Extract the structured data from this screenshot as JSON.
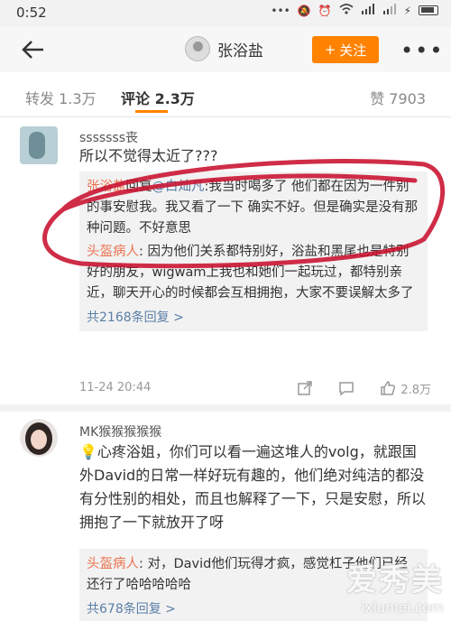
{
  "status_bar": {
    "time": "0:52"
  },
  "nav": {
    "title": "张浴盐",
    "follow_label": "关注",
    "follow_plus": "+",
    "more": "•••"
  },
  "tabs": {
    "repost": "转发 1.3万",
    "comment": "评论 2.3万",
    "like": "赞 7903"
  },
  "comments": [
    {
      "name": "sssssss丧",
      "text": "所以不觉得太近了???",
      "replies": [
        {
          "author": "张浴盐",
          "verb": "回复",
          "mention": "@白灿凡",
          "text": ":我当时喝多了 他们都在因为一件别的事安慰我。我又看了一下 确实不好。但是确实是没有那种问题。不好意思"
        },
        {
          "author": "头盔病人",
          "text": ": 因为他们关系都特别好，浴盐和黑尾也是特别好的朋友，wigwam上我也和她们一起玩过，都特别亲近，聊天开心的时候都会互相拥抱，大家不要误解太多了"
        }
      ],
      "more_replies": "共2168条回复 >",
      "time": "11-24 20:44",
      "likes": "2.8万"
    },
    {
      "name": "MK猴猴猴猴猴",
      "text": "心疼浴姐，你们可以看一遍这堆人的volg，就跟国外David的日常一样好玩有趣的，他们绝对纯洁的都没有分性别的相处，而且也解释了一下，只是安慰，所以拥抱了一下就放开了呀",
      "replies": [
        {
          "author": "头盔病人",
          "text": ": 对，David他们玩得才疯，感觉杠子他们已经还行了哈哈哈哈哈"
        }
      ],
      "more_replies": "共678条回复 >"
    }
  ],
  "watermark": {
    "main": "爱秀美",
    "sub": "ixiumei.com"
  },
  "colors": {
    "accent": "#ff8200",
    "link": "#5b7fa8",
    "reply_author": "#eb7350",
    "annotation": "#c8102e"
  }
}
